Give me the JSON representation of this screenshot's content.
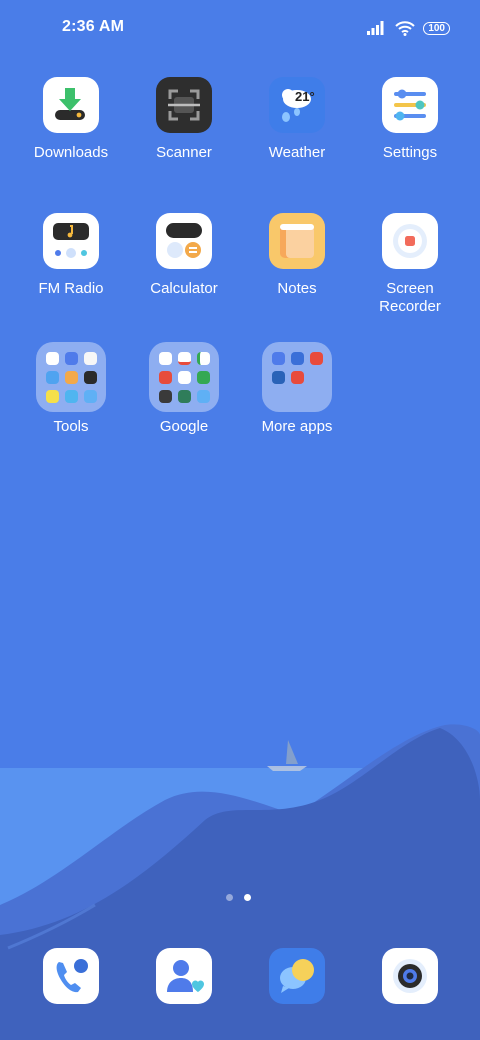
{
  "status_bar": {
    "time": "2:36 AM",
    "battery": "100",
    "icons": [
      "signal-icon",
      "wifi-icon",
      "battery-icon"
    ]
  },
  "apps": [
    {
      "label": "Downloads"
    },
    {
      "label": "Scanner"
    },
    {
      "label": "Weather",
      "temp": "21°"
    },
    {
      "label": "Settings"
    },
    {
      "label": "FM Radio"
    },
    {
      "label": "Calculator"
    },
    {
      "label": "Notes"
    },
    {
      "label": "Screen Recorder"
    }
  ],
  "folders": [
    {
      "label": "Tools"
    },
    {
      "label": "Google"
    },
    {
      "label": "More apps"
    }
  ],
  "page_indicator": {
    "pages": 2,
    "current": 2
  },
  "dock": [
    "phone-icon",
    "contacts-icon",
    "messages-icon",
    "camera-icon"
  ],
  "colors": {
    "sky": "#4a7de8",
    "sea": "#5b96f0",
    "hill": "#4368c7",
    "accent": "#f0a94a"
  }
}
